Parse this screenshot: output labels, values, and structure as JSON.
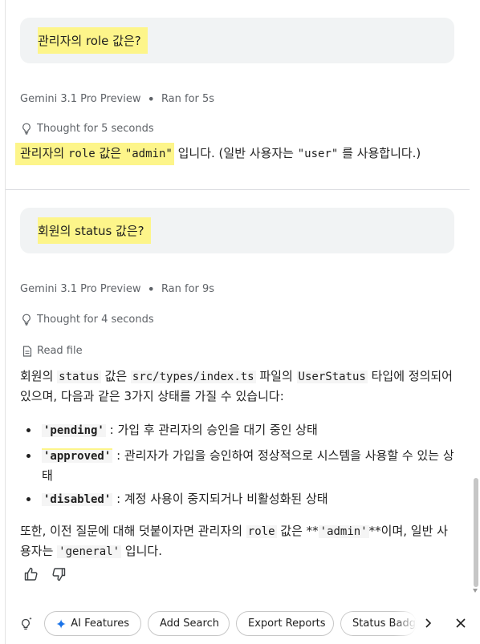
{
  "turn1": {
    "question": "관리자의 role 값은?",
    "model": "Gemini 3.1 Pro Preview",
    "ran": "Ran for 5s",
    "thought": "Thought for 5 seconds",
    "answer": {
      "a": "관리자의 ",
      "code1": "role",
      "b": " 값은 ",
      "code2": "\"admin\"",
      "c": " 입니다. (일반 사용자는 ",
      "code3": "\"user\"",
      "d": " 를 사용합니다.)"
    }
  },
  "turn2": {
    "question": "회원의 status 값은?",
    "model": "Gemini 3.1 Pro Preview",
    "ran": "Ran for 9s",
    "thought": "Thought for 4 seconds",
    "read_file": "Read file",
    "intro": {
      "a": "회원의 ",
      "code1": "status",
      "b": " 값은 ",
      "code2": "src/types/index.ts",
      "c": " 파일의 ",
      "code3": "UserStatus",
      "d": " 타입에 정의되어 있으며, 다음과 같은 3가지 상태를 가질 수 있습니다:"
    },
    "bullets": [
      {
        "code": "'pending'",
        "text": " : 가입 후 관리자의 승인을 대기 중인 상태"
      },
      {
        "code": "'approved'",
        "text": " : 관리자가 가입을 승인하여 정상적으로 시스템을 사용할 수 있는 상태"
      },
      {
        "code": "'disabled'",
        "text": " : 계정 사용이 중지되거나 비활성화된 상태"
      }
    ],
    "outro": {
      "a": "또한, 이전 질문에 대해 덧붙이자면 관리자의 ",
      "code1": "role",
      "b": " 값은 **",
      "code2": "'admin'",
      "c": "**이며, 일반 사용자는 ",
      "code3": "'general'",
      "d": " 입니다."
    }
  },
  "chips": {
    "ai_features": "AI Features",
    "add_search": "Add Search",
    "export_reports": "Export Reports",
    "status_badge": "Status Badge"
  },
  "icons": {
    "thought": "lightbulb-icon",
    "read_file": "file-icon",
    "thumbs_up": "thumbs-up-icon",
    "thumbs_down": "thumbs-down-icon",
    "ai": "sparkle-icon",
    "next": "chevron-right-icon",
    "close": "close-icon"
  },
  "colors": {
    "highlight": "#fdf58a",
    "bubble_bg": "#f1f3f4",
    "ai_accent": "#1a73e8"
  }
}
